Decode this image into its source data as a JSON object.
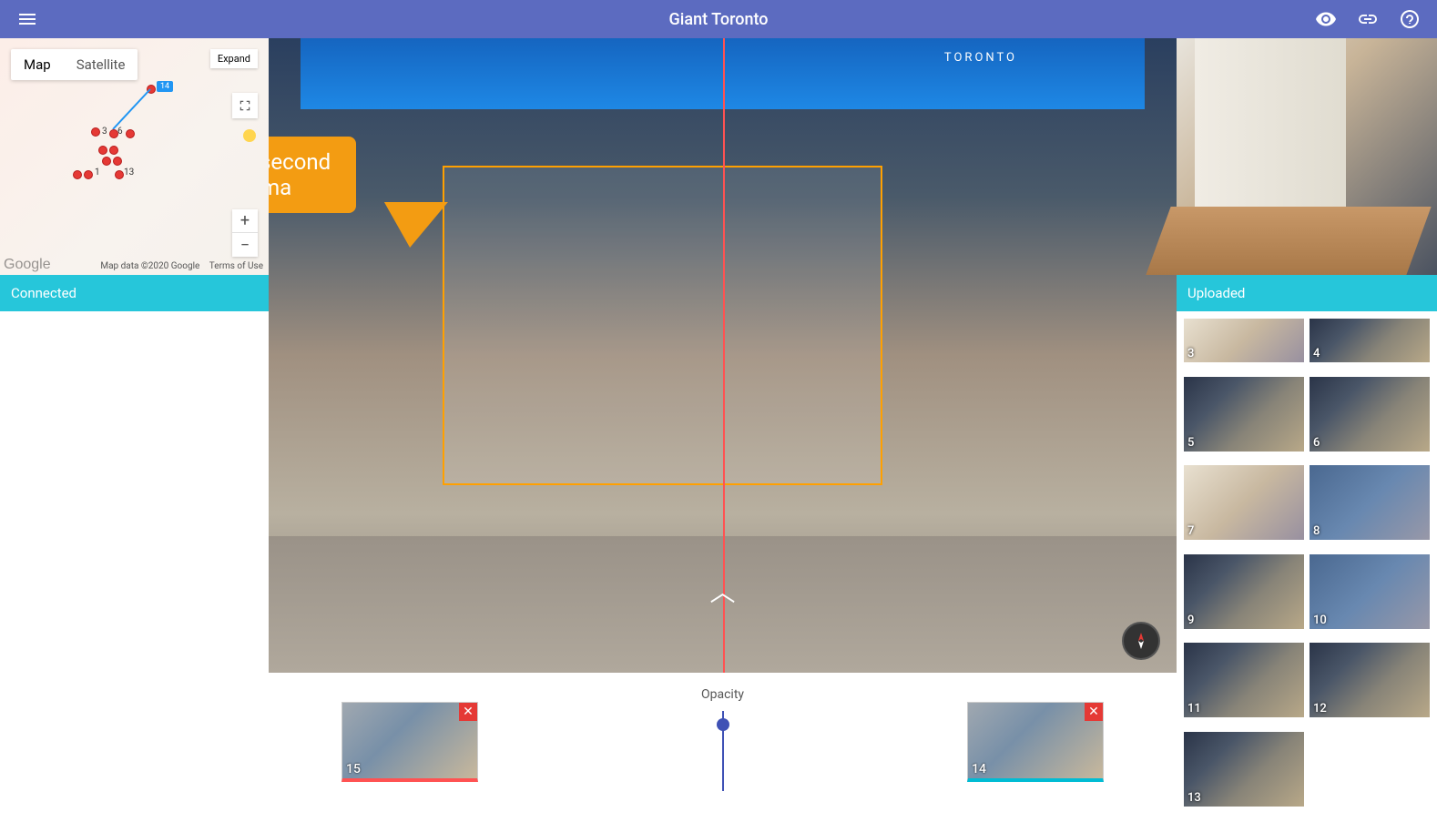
{
  "header": {
    "title": "Giant Toronto"
  },
  "map": {
    "tabMap": "Map",
    "tabSatellite": "Satellite",
    "expand": "Expand",
    "attribData": "Map data ©2020 Google",
    "attribTerms": "Terms of Use",
    "logo": "Google",
    "marker14": "14",
    "labels": {
      "l1": "1",
      "l3": "3",
      "l6": "6",
      "l13": "13"
    }
  },
  "status": {
    "connected": "Connected",
    "uploaded": "Uploaded"
  },
  "callout": {
    "line1": "Center the second",
    "line2": "panorama"
  },
  "viewer": {
    "signText": "TORONTO"
  },
  "bottom": {
    "opacityLabel": "Opacity",
    "leftThumbNum": "15",
    "rightThumbNum": "14",
    "close": "✕"
  },
  "thumbs": [
    {
      "n": "3",
      "cls": "light half"
    },
    {
      "n": "4",
      "cls": "half"
    },
    {
      "n": "5",
      "cls": ""
    },
    {
      "n": "6",
      "cls": ""
    },
    {
      "n": "7",
      "cls": "light"
    },
    {
      "n": "8",
      "cls": "blue"
    },
    {
      "n": "9",
      "cls": ""
    },
    {
      "n": "10",
      "cls": "blue"
    },
    {
      "n": "11",
      "cls": ""
    },
    {
      "n": "12",
      "cls": ""
    },
    {
      "n": "13",
      "cls": ""
    }
  ]
}
